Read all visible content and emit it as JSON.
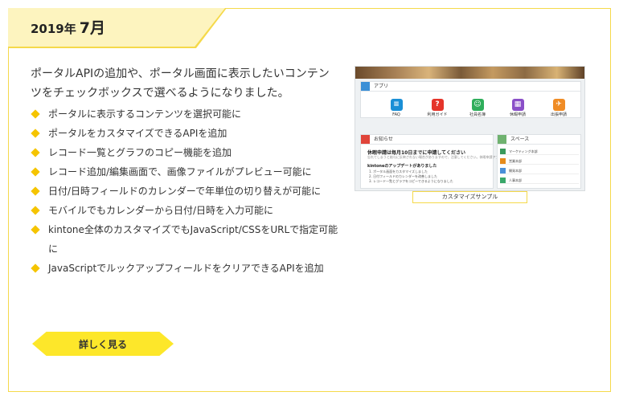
{
  "release": {
    "year": "2019年",
    "month": "7月"
  },
  "intro": "ポータルAPIの追加や、ポータル画面に表示したいコンテンツをチェックボックスで選べるようになりました。",
  "features": [
    "ポータルに表示するコンテンツを選択可能に",
    "ポータルをカスタマイズできるAPIを追加",
    "レコード一覧とグラフのコピー機能を追加",
    "レコード追加/編集画面で、画像ファイルがプレビュー可能に",
    "日付/日時フィールドのカレンダーで年単位の切り替えが可能に",
    "モバイルでもカレンダーから日付/日時を入力可能に",
    "kintone全体のカスタマイズでもJavaScript/CSSをURLで指定可能に",
    "JavaScriptでルックアップフィールドをクリアできるAPIを追加"
  ],
  "detail_button": "詳しく見る",
  "screenshot": {
    "apps_title": "アプリ",
    "apps": [
      {
        "label": "FAQ",
        "icon": "chat-bubbles-icon",
        "color": "#1a8fd6",
        "glyph": "≡"
      },
      {
        "label": "利用ガイド",
        "icon": "help-question-icon",
        "color": "#e5342a",
        "glyph": "?"
      },
      {
        "label": "社員名簿",
        "icon": "people-icon",
        "color": "#2fae5b",
        "glyph": "☺"
      },
      {
        "label": "休暇申請",
        "icon": "calendar-icon",
        "color": "#8a4fc8",
        "glyph": "▦"
      },
      {
        "label": "出張申請",
        "icon": "airplane-icon",
        "color": "#f08c25",
        "glyph": "✈"
      }
    ],
    "notice_title": "お知らせ",
    "notice_heading": "休暇申請は毎月10日までに申請してください",
    "notice_sub": "忘れてしまうと給与に反映されない場合がありますので、注意してください。休暇申請アプリはこちら。",
    "update_heading": "kintoneのアップデートがありました",
    "update_items": [
      "1. ポータル画面をカスタマイズしました",
      "2. 日付フィールドのカレンダーを改善しました",
      "3. レコード一覧とグラフをコピーできるようになりました"
    ],
    "space_title": "スペース",
    "spaces": [
      {
        "label": "マーケティング本部",
        "color": "#3a9a5c"
      },
      {
        "label": "営業本部",
        "color": "#e58b1c"
      },
      {
        "label": "開発本部",
        "color": "#4a90d9"
      },
      {
        "label": "人事本部",
        "color": "#3aa86a"
      }
    ],
    "caption": "カスタマイズサンプル"
  },
  "colors": {
    "accent_yellow": "#fde72a",
    "border_yellow": "#f5d94a",
    "bullet": "#f5c400",
    "date_tab": "#fdf4bf"
  }
}
